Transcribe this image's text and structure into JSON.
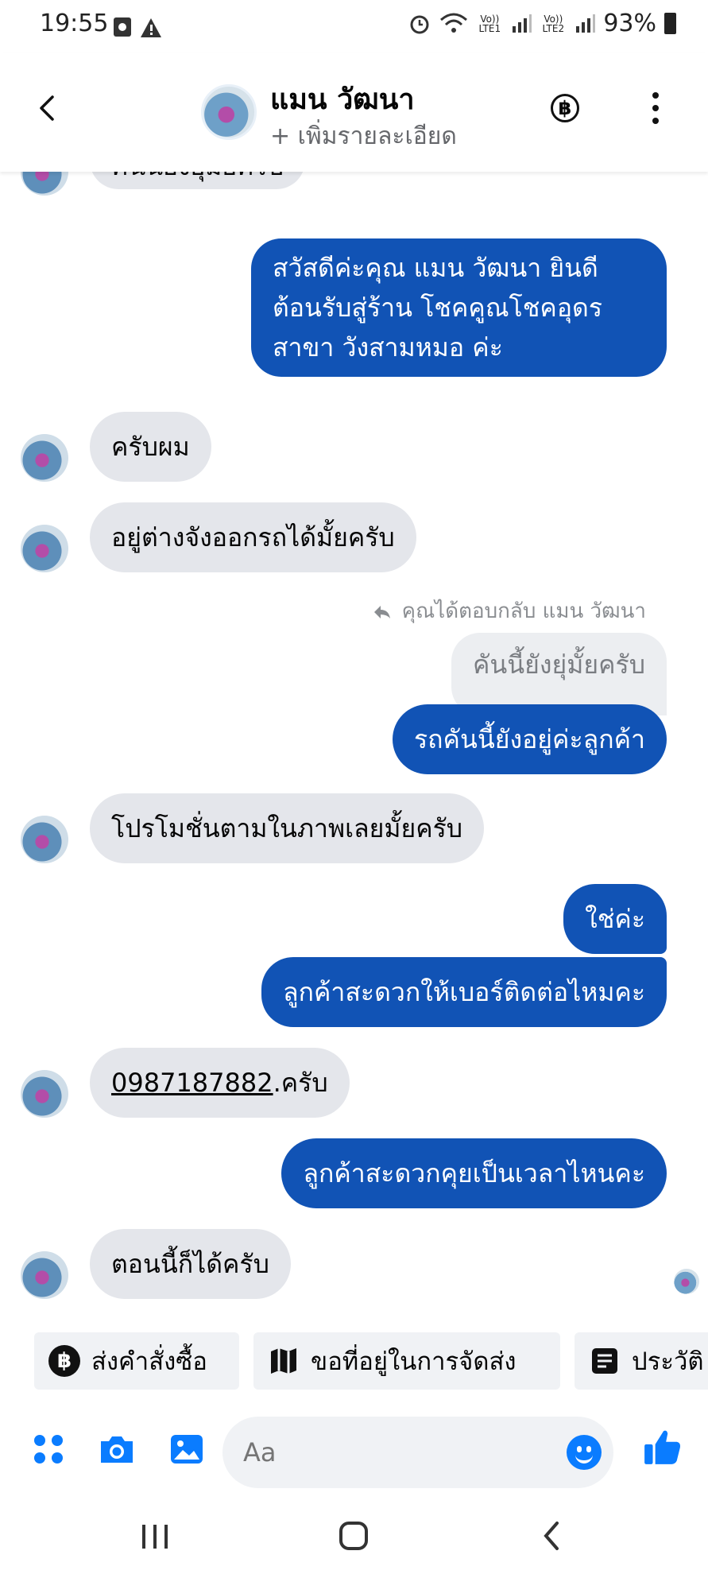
{
  "status_bar": {
    "time": "19:55",
    "signal_text_1": "Vo)) LTE1",
    "signal_text_2": "Vo)) LTE2",
    "battery": "93%"
  },
  "header": {
    "name": "แมน วัฒนา",
    "subtitle": "+ เพิ่มรายละเอียด",
    "baht_symbol": "฿"
  },
  "messages": [
    {
      "text": "คันนียังยุ่มัยครับ"
    },
    {
      "text": "สวัสดีค่ะคุณ แมน วัฒนา ยินดีต้อนรับสู่ร้าน โชคคูณโชคอุดร สาขา วังสามหมอ ค่ะ"
    },
    {
      "text": "ครับผม"
    },
    {
      "text": "อยู่ต่างจังออกรถได้มั้ยครับ"
    },
    {
      "text": "คุณได้ตอบกลับ แมน วัฒนา"
    },
    {
      "text": "คันนี้ยังยุ่มั้ยครับ"
    },
    {
      "text": "รถคันนี้ยังอยู่ค่ะลูกค้า"
    },
    {
      "text": "โปรโมชั่นตามในภาพเลยมั้ยครับ"
    },
    {
      "text": "ใช่ค่ะ"
    },
    {
      "text": "ลูกค้าสะดวกให้เบอร์ติดต่อไหมคะ"
    },
    {
      "phone": "0987187882",
      "suffix": ".ครับ"
    },
    {
      "text": "ลูกค้าสะดวกคุยเป็นเวลาไหนคะ"
    },
    {
      "text": "ตอนนี้ก็ได้ครับ"
    }
  ],
  "quick_actions": [
    {
      "label": "ส่งคำสั่งซื้อ",
      "icon": "baht-icon"
    },
    {
      "label": "ขอที่อยู่ในการจัดส่ง",
      "icon": "map-icon"
    },
    {
      "label": "ประวัติ",
      "icon": "document-icon"
    }
  ],
  "composer": {
    "placeholder": "Aa"
  },
  "colors": {
    "outgoing_bubble": "#1153b5",
    "incoming_bubble": "#e4e6eb",
    "accent": "#0a7cff"
  }
}
